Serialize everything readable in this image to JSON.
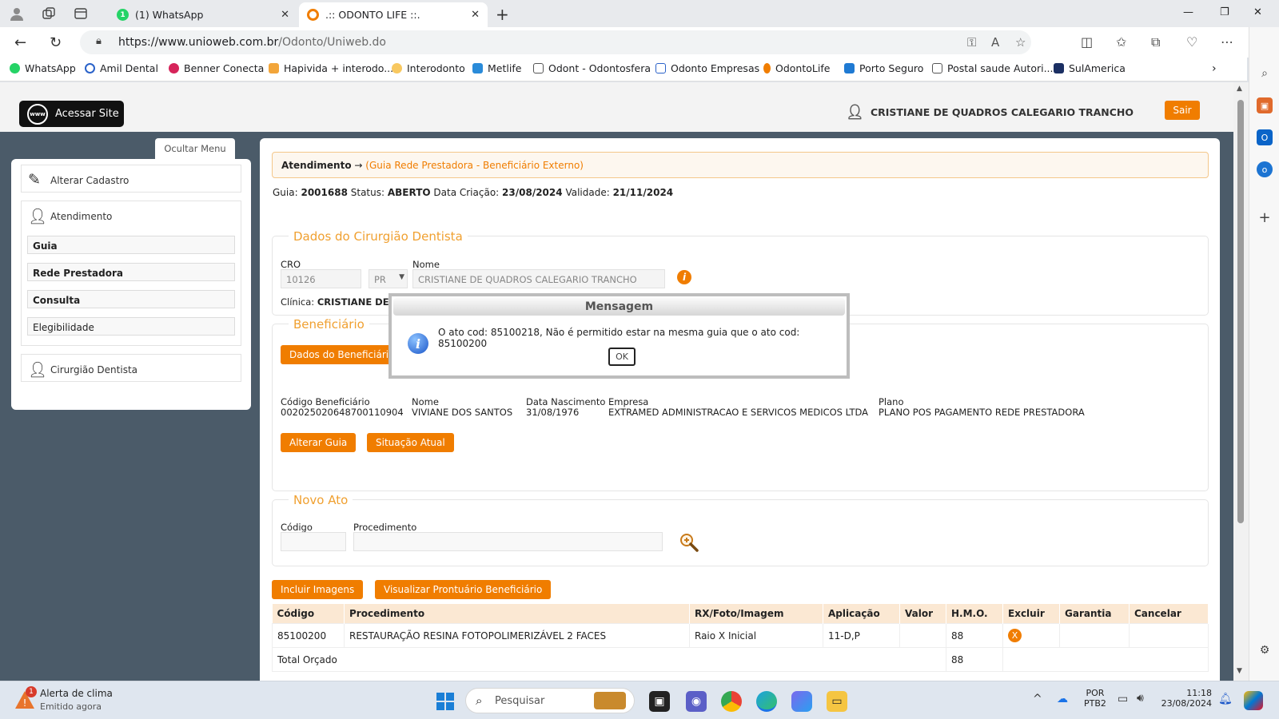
{
  "browser": {
    "tabs": [
      {
        "title": "(1) WhatsApp",
        "favicon_color": "#25d366",
        "favicon_text": "1"
      },
      {
        "title": ".:: ODONTO LIFE ::.",
        "favicon_color": "#f07d00",
        "favicon_text": ""
      }
    ],
    "url_host": "https://www.unioweb.com.br",
    "url_path": "/Odonto/Uniweb.do",
    "bookmarks": [
      "WhatsApp",
      "Amil Dental",
      "Benner Conecta",
      "Hapivida + interodo...",
      "Interodonto",
      "Metlife",
      "Odont - Odontosfera",
      "Odonto Empresas",
      "OdontoLife",
      "Porto Seguro",
      "Postal saude Autori...",
      "SulAmerica"
    ]
  },
  "header": {
    "site_button": "Acessar Site",
    "www": "www",
    "user_name": "CRISTIANE DE QUADROS CALEGARIO TRANCHO",
    "logout": "Sair"
  },
  "sidebar": {
    "toggle": "Ocultar Menu",
    "alterar_cadastro": "Alterar Cadastro",
    "atendimento": "Atendimento",
    "sub_items": [
      "Guia",
      "Rede Prestadora",
      "Consulta",
      "Elegibilidade"
    ],
    "cirurgiao": "Cirurgião Dentista"
  },
  "breadcrumb": {
    "section": "Atendimento",
    "arrow": "→",
    "detail": "(Guia Rede Prestadora - Beneficiário Externo)"
  },
  "guia_info": {
    "guia_label": "Guia:",
    "guia": "2001688",
    "status_label": "Status:",
    "status": "ABERTO",
    "criacao_label": "Data Criação:",
    "criacao": "23/08/2024",
    "validade_label": "Validade:",
    "validade": "21/11/2024"
  },
  "dentista": {
    "legend": "Dados do Cirurgião Dentista",
    "cro_label": "CRO",
    "cro": "10126",
    "uf": "PR",
    "nome_label": "Nome",
    "nome": "CRISTIANE DE QUADROS CALEGARIO TRANCHO",
    "clinica_label": "Clínica:",
    "clinica": "CRISTIANE DE"
  },
  "beneficiario": {
    "legend": "Beneficiário",
    "dados_btn": "Dados do Beneficiário",
    "codigo_label": "Código Beneficiário",
    "codigo": "002025020648700110904",
    "nome_label": "Nome",
    "nome": "VIVIANE DOS SANTOS",
    "nasc_label": "Data Nascimento",
    "nasc": "31/08/1976",
    "empresa_label": "Empresa",
    "empresa": "EXTRAMED ADMINISTRACAO E SERVICOS MEDICOS LTDA",
    "plano_label": "Plano",
    "plano": "PLANO POS PAGAMENTO REDE PRESTADORA",
    "alterar_btn": "Alterar Guia",
    "situacao_btn": "Situação Atual"
  },
  "novo_ato": {
    "legend": "Novo Ato",
    "codigo_label": "Código",
    "proc_label": "Procedimento"
  },
  "actions": {
    "incluir": "Incluir Imagens",
    "prontuario": "Visualizar Prontuário Beneficiário"
  },
  "table": {
    "headers": [
      "Código",
      "Procedimento",
      "RX/Foto/Imagem",
      "Aplicação",
      "Valor",
      "H.M.O.",
      "Excluir",
      "Garantia",
      "Cancelar"
    ],
    "row": {
      "codigo": "85100200",
      "procedimento": "RESTAURAÇÃO RESINA FOTOPOLIMERIZÁVEL 2 FACES",
      "rx": "Raio X Inicial",
      "aplicacao": "11-D,P",
      "valor": "",
      "hmo": "88",
      "excluir": "X"
    },
    "total_label": "Total Orçado",
    "total_hmo": "88"
  },
  "modal": {
    "title": "Mensagem",
    "message": "O ato cod: 85100218, Não é permitido estar na mesma guia que o ato cod: 85100200",
    "ok": "OK",
    "icon": "i"
  },
  "taskbar": {
    "weather_title": "Alerta de clima",
    "weather_sub": "Emitido agora",
    "weather_badge": "1",
    "search": "Pesquisar",
    "lang1": "POR",
    "lang2": "PTB2",
    "time": "11:18",
    "date": "23/08/2024"
  }
}
